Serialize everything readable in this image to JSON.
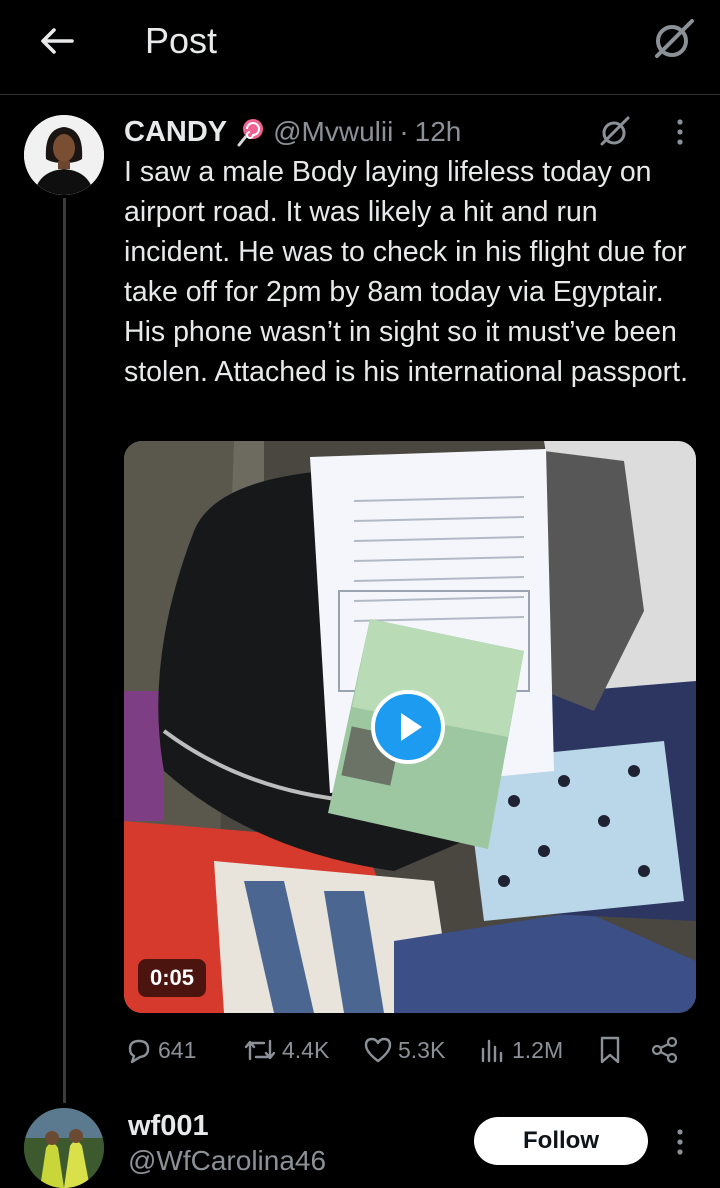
{
  "header": {
    "title": "Post"
  },
  "post": {
    "author": {
      "display_name": "CANDY",
      "handle": "@Mvwulii",
      "separator": "·",
      "time": "12h"
    },
    "text": "I saw a male Body  laying lifeless today on airport road. It was likely a hit and run incident. He was to check in his flight due for take off for 2pm by 8am today via Egyptair.  His phone wasn’t in sight so it must’ve been stolen. Attached is his international passport.",
    "media": {
      "type": "video",
      "duration": "0:05"
    },
    "stats": {
      "replies": "641",
      "reposts": "4.4K",
      "likes": "5.3K",
      "views": "1.2M"
    }
  },
  "reply": {
    "author": {
      "display_name": "wf001",
      "handle": "@WfCarolina46"
    },
    "follow_label": "Follow"
  },
  "colors": {
    "background": "#000000",
    "accent": "#1d9bf0",
    "muted": "#8b9197",
    "text": "#e7e9ea"
  }
}
